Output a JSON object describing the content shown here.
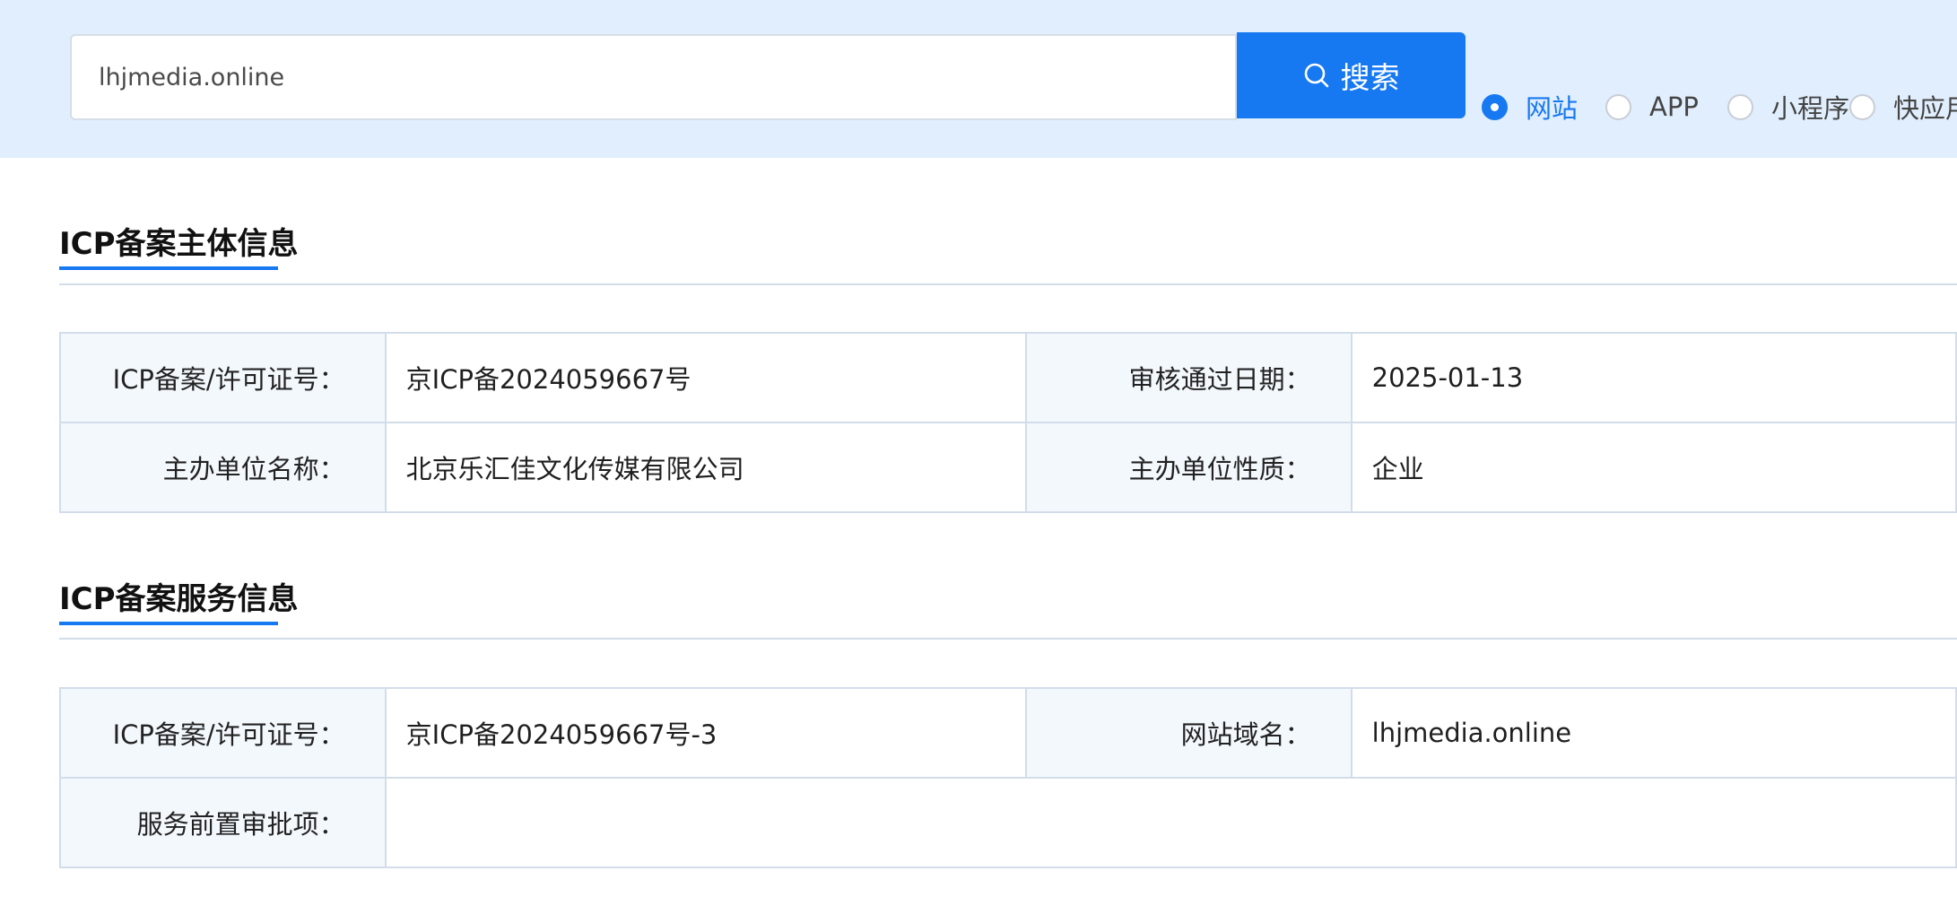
{
  "search": {
    "query": "lhjmedia.online",
    "button_label": "搜索",
    "options": [
      {
        "label": "网站",
        "checked": true
      },
      {
        "label": "APP",
        "checked": false
      },
      {
        "label": "小程序",
        "checked": false
      },
      {
        "label": "快应用",
        "checked": false
      }
    ]
  },
  "subject_section": {
    "title": "ICP备案主体信息",
    "rows": [
      {
        "label1": "ICP备案/许可证号：",
        "value1": "京ICP备2024059667号",
        "label2": "审核通过日期：",
        "value2": "2025-01-13"
      },
      {
        "label1": "主办单位名称：",
        "value1": "北京乐汇佳文化传媒有限公司",
        "label2": "主办单位性质：",
        "value2": "企业"
      }
    ]
  },
  "service_section": {
    "title": "ICP备案服务信息",
    "row1": {
      "label1": "ICP备案/许可证号：",
      "value1": "京ICP备2024059667号-3",
      "label2": "网站域名：",
      "value2": "lhjmedia.online"
    },
    "row2": {
      "label": "服务前置审批项：",
      "value": ""
    }
  },
  "colors": {
    "accent": "#1779f2",
    "band_background": "#e1eefd",
    "label_cell_background": "#f3f8fd",
    "border": "#d2dde9"
  },
  "icons": {
    "search_button": "search-icon"
  }
}
